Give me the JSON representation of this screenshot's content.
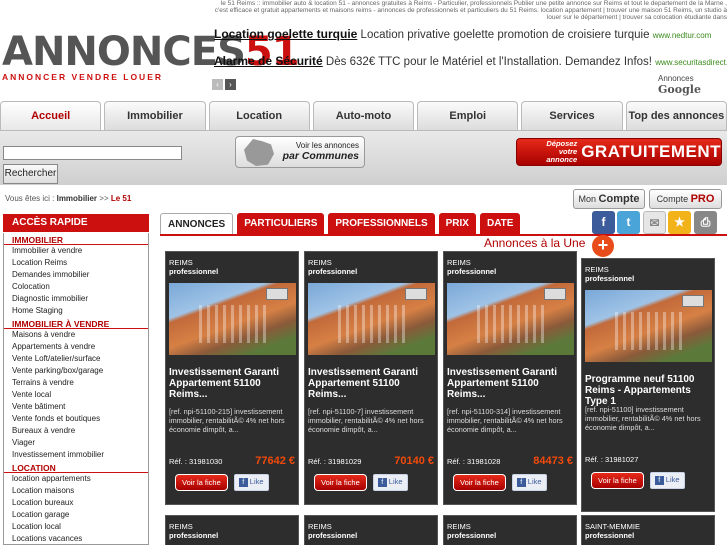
{
  "header": {
    "tagline": "le 51 Reims :: immobilier auto & location 51 - annonces gratuites à Reims - Particulier, professionnels Publier une petite annonce sur Reims et tout le departement de la Marne , c'est efficace et gratuit appartements et maisons reims - annonces de professionnels et particuliers du 51 Reims. location appartement | trouver une maison 51 Reims, un studio à louer sur le département | trouver sa colocation étudiante dans",
    "logo_text": "ANNONCES",
    "logo_number": "51",
    "logo_sub": "ANNONCER VENDRE LOUER"
  },
  "ads": [
    {
      "title": "Location goelette turquie",
      "text": "Location privative goelette promotion de croisiere turquie",
      "url": "www.nedtur.com"
    },
    {
      "title": "Alarme de Sécurité",
      "text": "Dès 632€ TTC pour le Matériel et l'Installation. Demandez Infos!",
      "url": "www.securitasdirect.fr"
    }
  ],
  "ad_nav": {
    "prev": "‹",
    "next": "›"
  },
  "ads_by": {
    "label": "Annonces",
    "brand": "Google"
  },
  "nav_tabs": [
    "Accueil",
    "Immobilier",
    "Location",
    "Auto-moto",
    "Emploi",
    "Services",
    "Top des annonces"
  ],
  "search": {
    "value": "",
    "button": "Rechercher"
  },
  "communes": {
    "line1": "Voir les annonces",
    "line2": "par Communes"
  },
  "deposer": {
    "line1": "Déposez votre",
    "line2": "annonce",
    "big": "GRATUITEMENT"
  },
  "breadcrumb": {
    "prefix": "Vous êtes ici :",
    "item1": "Immobilier",
    "sep": ">>",
    "item2": "Le 51"
  },
  "account": {
    "mon": "Mon",
    "compte": "Compte",
    "compte2": "Compte",
    "pro": "PRO"
  },
  "social": {
    "facebook": "f",
    "twitter": "t",
    "mail": "✉",
    "star": "★",
    "print": "⎙"
  },
  "sidebar": {
    "title": "ACCÈS RAPIDE",
    "sections": [
      {
        "title": "IMMOBILIER",
        "items": [
          "Immobilier à vendre",
          "Location Reims",
          "Demandes immobilier",
          "Colocation",
          "Diagnostic immobilier",
          "Home Staging"
        ]
      },
      {
        "title": "IMMOBILIER À VENDRE",
        "items": [
          "Maisons à vendre",
          "Appartements à vendre",
          "Vente Loft/atelier/surface",
          "Vente parking/box/garage",
          "Terrains à vendre",
          "Vente local",
          "Vente bâtiment",
          "Vente fonds et boutiques",
          "Bureaux à vendre",
          "Viager",
          "Investissement immobilier"
        ]
      },
      {
        "title": "LOCATION",
        "items": [
          "location appartements",
          "Location maisons",
          "Location bureaux",
          "Location garage",
          "Location local",
          "Locations vacances"
        ]
      }
    ]
  },
  "content_tabs": [
    "ANNONCES",
    "PARTICULIERS",
    "PROFESSIONNELS",
    "PRIX",
    "DATE"
  ],
  "une_label": "Annonces à la Une",
  "plus": "+",
  "cards": [
    {
      "city": "REIMS",
      "type": "professionnel",
      "title": "Investissement Garanti Appartement 51100 Reims...",
      "desc": "[ref. npi-51100-215] investissement immobilier, rentabilitÃ© 4% net hors économie dimpôt, a...",
      "ref": "Réf. : 31981030",
      "price": "77642 €",
      "btn": "Voir la fiche",
      "like": "Like"
    },
    {
      "city": "REIMS",
      "type": "professionnel",
      "title": "Investissement Garanti Appartement 51100 Reims...",
      "desc": "[ref. npi-51100-7] investissement immobilier, rentabilitÃ© 4% net hors économie dimpôt, a...",
      "ref": "Réf. : 31981029",
      "price": "70140 €",
      "btn": "Voir la fiche",
      "like": "Like"
    },
    {
      "city": "REIMS",
      "type": "professionnel",
      "title": "Investissement Garanti Appartement 51100 Reims...",
      "desc": "[ref. npi-51100-314] investissement immobilier, rentabilitÃ© 4% net hors économie dimpôt, a...",
      "ref": "Réf. : 31981028",
      "price": "84473 €",
      "btn": "Voir la fiche",
      "like": "Like"
    },
    {
      "city": "REIMS",
      "type": "professionnel",
      "title": "Programme neuf 51100 Reims - Appartements Type 1",
      "desc": "[ref. npi-51100] investissement immobilier, rentabilitÃ© 4% net hors économie dimpôt, a...",
      "ref": "Réf. : 31981027",
      "price": "",
      "btn": "Voir la fiche",
      "like": "Like"
    }
  ],
  "bottom_cards": [
    {
      "city": "REIMS",
      "type": "professionnel"
    },
    {
      "city": "REIMS",
      "type": "professionnel"
    },
    {
      "city": "REIMS",
      "type": "professionnel"
    },
    {
      "city": "SAINT-MEMMIE",
      "type": "professionnel"
    }
  ]
}
